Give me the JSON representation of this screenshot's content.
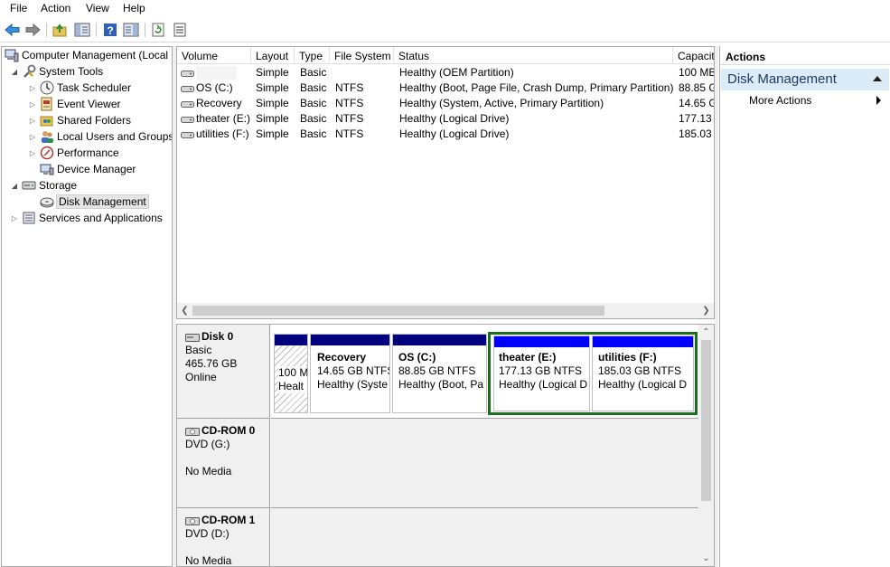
{
  "menu": [
    "File",
    "Action",
    "View",
    "Help"
  ],
  "toolbar": {
    "icons": [
      "back-arrow-icon",
      "forward-arrow-icon",
      "up-folder-icon",
      "show-hide-tree-icon",
      "help-icon",
      "show-hide-action-pane-icon",
      "refresh-icon",
      "properties-icon"
    ]
  },
  "tree": {
    "root": "Computer Management (Local",
    "system_tools": "System Tools",
    "task_scheduler": "Task Scheduler",
    "event_viewer": "Event Viewer",
    "shared_folders": "Shared Folders",
    "local_users": "Local Users and Groups",
    "performance": "Performance",
    "device_manager": "Device Manager",
    "storage": "Storage",
    "disk_management": "Disk Management",
    "services": "Services and Applications"
  },
  "volume_list": {
    "columns": [
      "Volume",
      "Layout",
      "Type",
      "File System",
      "Status",
      "Capacit"
    ],
    "rows": [
      {
        "volume": "",
        "layout": "Simple",
        "type": "Basic",
        "fs": "",
        "status": "Healthy (OEM Partition)",
        "capacity": "100 MB"
      },
      {
        "volume": "OS (C:)",
        "layout": "Simple",
        "type": "Basic",
        "fs": "NTFS",
        "status": "Healthy (Boot, Page File, Crash Dump, Primary Partition)",
        "capacity": "88.85 G"
      },
      {
        "volume": "Recovery",
        "layout": "Simple",
        "type": "Basic",
        "fs": "NTFS",
        "status": "Healthy (System, Active, Primary Partition)",
        "capacity": "14.65 G"
      },
      {
        "volume": "theater (E:)",
        "layout": "Simple",
        "type": "Basic",
        "fs": "NTFS",
        "status": "Healthy (Logical Drive)",
        "capacity": "177.13 G"
      },
      {
        "volume": "utilities (F:)",
        "layout": "Simple",
        "type": "Basic",
        "fs": "NTFS",
        "status": "Healthy (Logical Drive)",
        "capacity": "185.03 G"
      }
    ]
  },
  "disks": {
    "disk0": {
      "name": "Disk 0",
      "type": "Basic",
      "size": "465.76 GB",
      "state": "Online"
    },
    "cdrom0": {
      "name": "CD-ROM 0",
      "type": "DVD (G:)",
      "state": "No Media"
    },
    "cdrom1": {
      "name": "CD-ROM 1",
      "type": "DVD (D:)",
      "state": "No Media"
    }
  },
  "partitions": {
    "oem": {
      "size": "100 M",
      "status": "Healt"
    },
    "recovery": {
      "name": "Recovery",
      "size": "14.65 GB NTFS",
      "status": "Healthy (Syste"
    },
    "os": {
      "name": "OS  (C:)",
      "size": "88.85 GB NTFS",
      "status": "Healthy (Boot, Pa"
    },
    "theater": {
      "name": "theater  (E:)",
      "size": "177.13 GB NTFS",
      "status": "Healthy (Logical D"
    },
    "utilities": {
      "name": "utilities  (F:)",
      "size": "185.03 GB NTFS",
      "status": "Healthy (Logical D"
    }
  },
  "actions": {
    "header": "Actions",
    "section": "Disk Management",
    "more": "More Actions"
  },
  "colors": {
    "primary_partition": "#00007f",
    "logical_drive": "#0000ff",
    "extended_border": "#1b6e1b",
    "action_section_bg": "#dcebf8"
  }
}
